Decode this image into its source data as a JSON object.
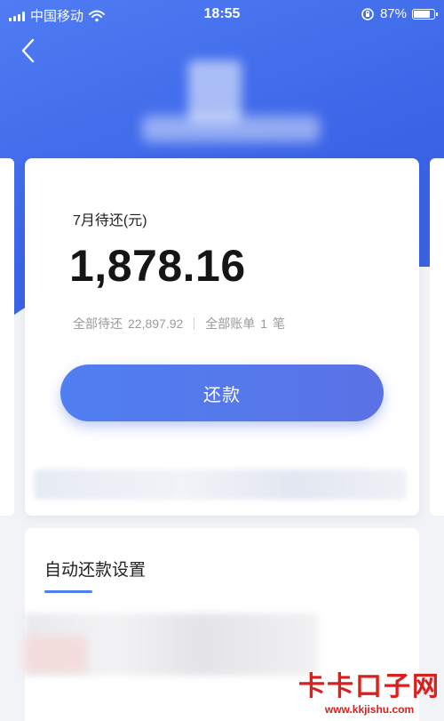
{
  "status_bar": {
    "carrier": "中国移动",
    "time": "18:55",
    "battery": "87%"
  },
  "bill": {
    "due_label": "7月待还(元)",
    "amount": "1,878.16",
    "total_pending_label": "全部待还",
    "total_pending_value": "22,897.92",
    "all_bills_label": "全部账单",
    "all_bills_count": "1",
    "all_bills_unit": "笔",
    "repay_button": "还款"
  },
  "auto_repay": {
    "title": "自动还款设置"
  },
  "watermark": {
    "name": "卡卡口子网",
    "url": "www.kkjishu.com"
  },
  "colors": {
    "brand_blue": "#4f7ff0",
    "watermark_red": "#d9201c"
  },
  "icons": [
    "signal-icon",
    "wifi-icon",
    "orientation-lock-icon",
    "battery-icon",
    "back-arrow-icon"
  ]
}
